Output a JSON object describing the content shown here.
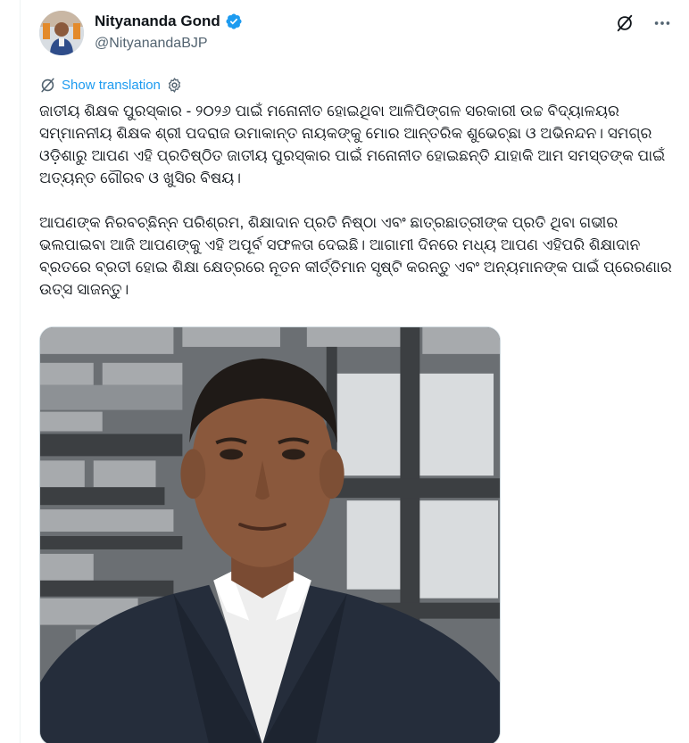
{
  "author": {
    "display_name": "Nityananda Gond",
    "handle": "@NityanandaBJP",
    "avatar_icon": "profile-photo",
    "verified": true,
    "verified_color": "#1d9bf0"
  },
  "actions": {
    "grok_icon": "grok-slash-circle-icon",
    "more_icon": "more-horizontal-icon"
  },
  "translate": {
    "label": "Show translation",
    "icon": "translate-globe-icon",
    "settings_icon": "gear-icon",
    "color": "#1d9bf0"
  },
  "tweet": {
    "paragraphs": [
      "ଜାତୀୟ ଶିକ୍ଷକ ପୁରସ୍କାର - ୨୦୨୬ ପାଇଁ ମନୋନୀତ ହୋଇଥିବା ଆଳିପିଙ୍ଗଳ ସରକାରୀ ଉଚ୍ଚ ବିଦ୍ୟାଳୟର ସମ୍ମାନନୀୟ ଶିକ୍ଷକ ଶ୍ରୀ ପଦରାଜ ଉମାକାନ୍ତ ନାୟକଙ୍କୁ ମୋର ଆନ୍ତରିକ ଶୁଭେଚ୍ଛା ଓ ଅଭିନନ୍ଦନ। ସମଗ୍ର ଓଡ଼ିଶାରୁ ଆପଣ ଏହି ପ୍ରତିଷ୍ଠିତ ଜାତୀୟ ପୁରସ୍କାର ପାଇଁ ମନୋନୀତ ହୋଇଛନ୍ତି ଯାହାକି ଆମ ସମସ୍ତଙ୍କ ପାଇଁ ଅତ୍ୟନ୍ତ ଗୌରବ ଓ ଖୁସିର ବିଷୟ।",
      "ଆପଣଙ୍କ ନିରବଚ୍ଛିନ୍ନ ପରିଶ୍ରମ, ଶିକ୍ଷାଦାନ ପ୍ରତି ନିଷ୍ଠା ଏବଂ ଛାତ୍ରଛାତ୍ରୀଙ୍କ ପ୍ରତି ଥିବା ଗଭୀର ଭଲପାଇବା ଆଜି ଆପଣଙ୍କୁ ଏହି ଅପୂର୍ବ ସଫଳତା ଦେଇଛି। ଆଗାମୀ ଦିନରେ ମଧ୍ୟ ଆପଣ ଏହିପରି ଶିକ୍ଷାଦାନ ବ୍ରତରେ ବ୍ରତୀ ହୋଇ ଶିକ୍ଷା କ୍ଷେତ୍ରରେ ନୂତନ କୀର୍ତ୍ତିମାନ ସୃଷ୍ଟି କରନ୍ତୁ ଏବଂ ଅନ୍ୟମାନଙ୍କ ପାଇଁ ପ୍ରେରଣାର ଉତ୍ସ ସାଜନ୍ତୁ।"
    ]
  },
  "media": {
    "type": "photo",
    "subject_icon": "portrait-photo"
  }
}
